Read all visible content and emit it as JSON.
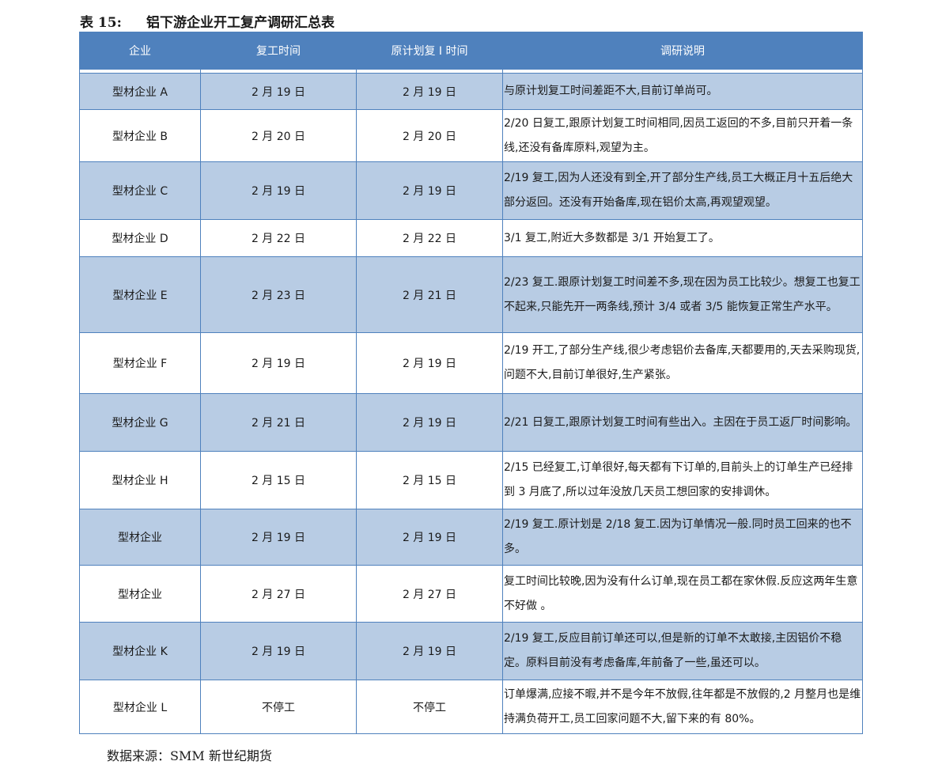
{
  "caption": {
    "number": "表 15:",
    "title": "铝下游企业开工复产调研汇总表"
  },
  "table": {
    "headers": [
      "企业",
      "复工时间",
      "原计划复 I 时间",
      "调研说明"
    ],
    "rows": [
      {
        "company": "型材企业 A",
        "resume": "2 月 19 日",
        "planned": "2 月 19 日",
        "note": "与原计划复工时间差距不大,目前订单尚可。"
      },
      {
        "company": "型材企业 B",
        "resume": "2 月 20 日",
        "planned": "2 月 20 日",
        "note": "2/20 日复工,跟原计划复工时间相同,因员工返回的不多,目前只开着一条线,还没有备库原料,观望为主。"
      },
      {
        "company": "型材企业 C",
        "resume": "2 月 19 日",
        "planned": "2 月 19 日",
        "note": "2/19 复工,因为人还没有到全,开了部分生产线,员工大概正月十五后绝大部分返回。还没有开始备库,现在铝价太高,再观望观望。"
      },
      {
        "company": "型材企业 D",
        "resume": "2 月 22 日",
        "planned": "2 月 22 日",
        "note": "3/1 复工,附近大多数都是 3/1 开始复工了。"
      },
      {
        "company": "型材企业 E",
        "resume": "2 月 23 日",
        "planned": "2 月 21 日",
        "note": "2/23 复工.跟原计划复工时间差不多,现在因为员工比较少。想复工也复工不起来,只能先开一两条线,预计 3/4 或者 3/5 能恢复正常生产水平。"
      },
      {
        "company": "型材企业 F",
        "resume": "2 月 19 日",
        "planned": "2 月 19 日",
        "note": "2/19 开工,了部分生产线,很少考虑铝价去备库,天都要用的,天去采购现货,问题不大,目前订单很好,生产紧张。"
      },
      {
        "company": "型材企业 G",
        "resume": "2 月 21 日",
        "planned": "2 月 19 日",
        "note": "2/21 日复工,跟原计划复工时间有些出入。主因在于员工返厂时间影响。"
      },
      {
        "company": "型材企业 H",
        "resume": "2 月 15 日",
        "planned": "2 月 15 日",
        "note": "2/15 已经复工,订单很好,每天都有下订单的,目前头上的订单生产已经排到 3 月底了,所以过年没放几天员工想回家的安排调休。"
      },
      {
        "company": "型材企业",
        "resume": "2 月 19 日",
        "planned": "2 月 19 日",
        "note": "2/19 复工.原计划是 2/18 复工.因为订单情况一般.同时员工回来的也不多。"
      },
      {
        "company": "型材企业",
        "resume": "2 月 27 日",
        "planned": "2 月 27 日",
        "note": "复工时间比较晚,因为没有什么订单,现在员工都在家休假.反应这两年生意不好做  。"
      },
      {
        "company": "型材企业 K",
        "resume": "2 月 19 日",
        "planned": "2 月 19 日",
        "note": "2/19 复工,反应目前订单还可以,但是新的订单不太敢接,主因铝价不稳定。原料目前没有考虑备库,年前备了一些,虽还可以。"
      },
      {
        "company": "型材企业 L",
        "resume": "不停工",
        "planned": "不停工",
        "note": "订单爆满,应接不暇,并不是今年不放假,往年都是不放假的,2 月整月也是维持满负荷开工,员工回家问题不大,留下来的有 80%。"
      }
    ]
  },
  "source": "数据来源：SMM 新世纪期货",
  "colors": {
    "header_bg": "#4f81bd",
    "shade_bg": "#b8cce4",
    "border": "#4f81bd"
  }
}
